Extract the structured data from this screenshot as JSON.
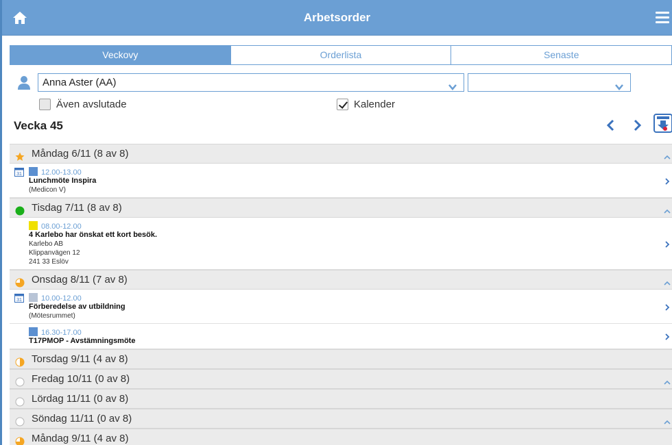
{
  "header": {
    "title": "Arbetsorder"
  },
  "tabs": [
    {
      "label": "Veckovy",
      "active": true
    },
    {
      "label": "Orderlista",
      "active": false
    },
    {
      "label": "Senaste",
      "active": false
    }
  ],
  "filters": {
    "user_select": "Anna Aster (AA)",
    "second_select": "",
    "include_closed_label": "Även avslutade",
    "include_closed_checked": false,
    "calendar_label": "Kalender",
    "calendar_checked": true
  },
  "week": {
    "title": "Vecka 45"
  },
  "colors": {
    "accent": "#6b9fd4",
    "star": "#f5a623",
    "green": "#1aaf1a",
    "orange": "#f5a623",
    "yellow": "#f0e000",
    "blue_square": "#5b8fd0",
    "grey_square": "#b8c4d6"
  },
  "days": [
    {
      "label": "Måndag 6/11 (8 av 8)",
      "icon": "star-icon",
      "collapsible": true,
      "items": [
        {
          "calendar": true,
          "square": "blue",
          "time": "12.00-13.00",
          "title": "Lunchmöte Inspira",
          "lines": [
            "(Medicon V)"
          ]
        }
      ]
    },
    {
      "label": "Tisdag 7/11 (8 av 8)",
      "icon": "full-circle-icon",
      "collapsible": true,
      "items": [
        {
          "calendar": false,
          "square": "yellow",
          "time": "08.00-12.00",
          "title": "4 Karlebo har önskat ett kort besök.",
          "lines": [
            "Karlebo AB",
            "Klippanvägen 12",
            "241 33 Eslöv"
          ]
        }
      ]
    },
    {
      "label": "Onsdag 8/11 (7 av 8)",
      "icon": "three-quarter-circle-icon",
      "collapsible": true,
      "items": [
        {
          "calendar": true,
          "square": "grey",
          "time": "10.00-12.00",
          "title": "Förberedelse av utbildning",
          "lines": [
            "(Mötesrummet)"
          ]
        },
        {
          "calendar": false,
          "square": "blue",
          "time": "16.30-17.00",
          "title": "T17PMOP - Avstämningsmöte",
          "lines": []
        }
      ]
    },
    {
      "label": "Torsdag 9/11 (4 av 8)",
      "icon": "half-circle-icon",
      "collapsible": false,
      "items": []
    },
    {
      "label": "Fredag 10/11 (0 av 8)",
      "icon": "empty-circle-icon",
      "collapsible": true,
      "items": []
    },
    {
      "label": "Lördag 11/11 (0 av 8)",
      "icon": "empty-circle-icon",
      "collapsible": false,
      "items": []
    },
    {
      "label": "Söndag 11/11 (0 av 8)",
      "icon": "empty-circle-icon",
      "collapsible": true,
      "items": []
    },
    {
      "label": "Måndag 9/11 (4 av 8)",
      "icon": "three-quarter-circle-icon",
      "collapsible": false,
      "items": []
    }
  ]
}
